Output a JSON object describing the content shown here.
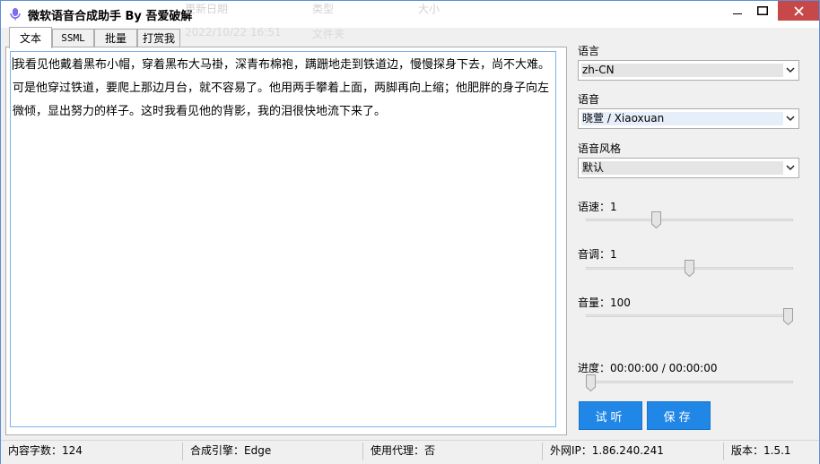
{
  "window": {
    "title": "微软语音合成助手 By 吾爱破解",
    "ghost_labels": [
      "更新日期",
      "类型",
      "大小"
    ],
    "ghost_row": [
      "2022/10/22 16:51",
      "文件夹"
    ]
  },
  "tabs": [
    {
      "label": "文本",
      "active": true
    },
    {
      "label": "SSML",
      "active": false
    },
    {
      "label": "批量",
      "active": false
    },
    {
      "label": "打赏我",
      "active": false
    }
  ],
  "editor": {
    "text": "我看见他戴着黑布小帽，穿着黑布大马褂，深青布棉袍，蹒跚地走到铁道边，慢慢探身下去，尚不大难。可是他穿过铁道，要爬上那边月台，就不容易了。他用两手攀着上面，两脚再向上缩；他肥胖的身子向左微倾，显出努力的样子。这时我看见他的背影，我的泪很快地流下来了。"
  },
  "panel": {
    "language_label": "语言",
    "language_value": "zh-CN",
    "voice_label": "语音",
    "voice_value": "晓萱 / Xiaoxuan",
    "style_label": "语音风格",
    "style_value": "默认",
    "rate_label": "语速：1",
    "rate_fraction": 0.33,
    "pitch_label": "音调：1",
    "pitch_fraction": 0.5,
    "volume_label": "音量：100",
    "volume_fraction": 1.0,
    "progress_label": "进度：00:00:00 / 00:00:00",
    "progress_fraction": 0.0,
    "listen_button": "试听",
    "save_button": "保存"
  },
  "status": {
    "char_count": "内容字数：124",
    "engine": "合成引擎：Edge",
    "proxy": "使用代理：否",
    "ip": "外网IP：1.86.240.241",
    "version": "版本：1.5.1"
  },
  "colors": {
    "accent": "#2187e7",
    "close": "#c74848",
    "border": "#7eb4ea"
  }
}
